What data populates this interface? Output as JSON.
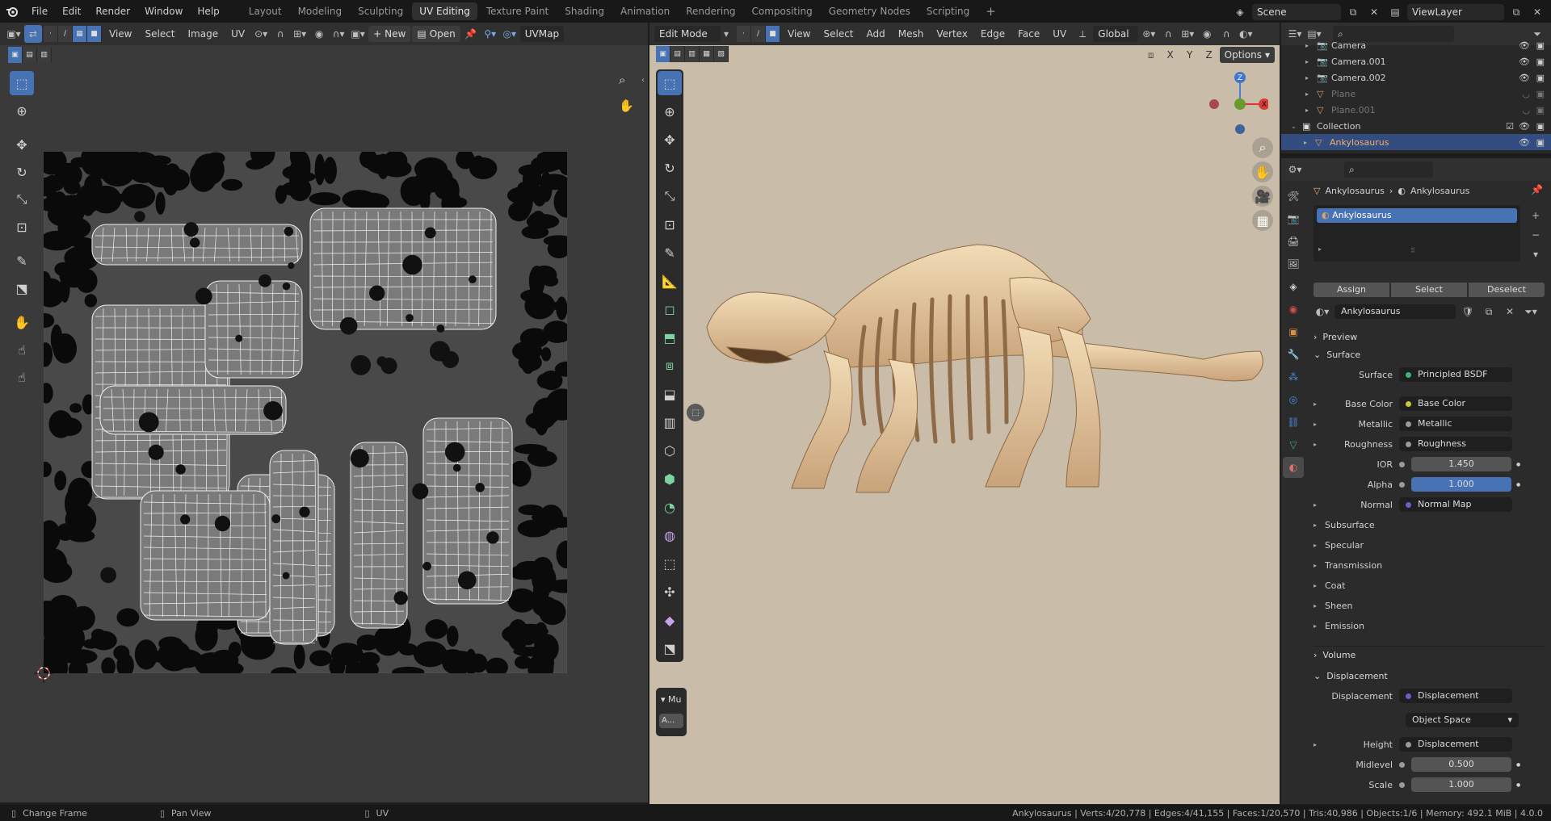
{
  "topbar": {
    "menus": [
      "File",
      "Edit",
      "Render",
      "Window",
      "Help"
    ],
    "workspaces": [
      "Layout",
      "Modeling",
      "Sculpting",
      "UV Editing",
      "Texture Paint",
      "Shading",
      "Animation",
      "Rendering",
      "Compositing",
      "Geometry Nodes",
      "Scripting"
    ],
    "active_workspace": "UV Editing",
    "add_workspace": "+",
    "scene": "Scene",
    "view_layer": "ViewLayer"
  },
  "uv_editor": {
    "menus": [
      "View",
      "Select",
      "Image",
      "UV"
    ],
    "new_label": "New",
    "open_label": "Open",
    "uvmap_label": "UVMap"
  },
  "viewport": {
    "mode": "Edit Mode",
    "menus": [
      "View",
      "Select",
      "Add",
      "Mesh",
      "Vertex",
      "Edge",
      "Face",
      "UV"
    ],
    "orientation": "Global",
    "options_label": "Options",
    "axis_x": "X",
    "axis_y": "Y",
    "axis_z": "Z",
    "gizmo_x": "X",
    "gizmo_z": "Z",
    "last_op_label": "Mu",
    "last_op_short": "A..."
  },
  "outliner": {
    "items": [
      {
        "label": "Camera",
        "kind": "camera",
        "dim": false
      },
      {
        "label": "Camera.001",
        "kind": "camera",
        "dim": false
      },
      {
        "label": "Camera.002",
        "kind": "camera",
        "dim": false
      },
      {
        "label": "Plane",
        "kind": "mesh",
        "dim": true
      },
      {
        "label": "Plane.001",
        "kind": "mesh",
        "dim": true
      },
      {
        "label": "Collection",
        "kind": "collection",
        "dim": false
      },
      {
        "label": "Ankylosaurus",
        "kind": "mesh",
        "dim": false,
        "selected": true
      }
    ]
  },
  "properties": {
    "breadcrumb_object": "Ankylosaurus",
    "breadcrumb_material": "Ankylosaurus",
    "slot_name": "Ankylosaurus",
    "assign_label": "Assign",
    "select_label": "Select",
    "deselect_label": "Deselect",
    "material_name": "Ankylosaurus",
    "preview_label": "Preview",
    "surface_section": "Surface",
    "surface_label": "Surface",
    "surface_value": "Principled BSDF",
    "rows": [
      {
        "label": "Base Color",
        "value": "Base Color",
        "dot": "#c8c83c",
        "expand": true
      },
      {
        "label": "Metallic",
        "value": "Metallic",
        "dot": "#9a9a9a",
        "expand": true
      },
      {
        "label": "Roughness",
        "value": "Roughness",
        "dot": "#9a9a9a",
        "expand": true
      },
      {
        "label": "IOR",
        "value": "1.450",
        "dot": "#9a9a9a",
        "expand": false,
        "style": "grey"
      },
      {
        "label": "Alpha",
        "value": "1.000",
        "dot": "#9a9a9a",
        "expand": false,
        "style": "blue"
      },
      {
        "label": "Normal",
        "value": "Normal Map",
        "dot": "#6363c7",
        "expand": true
      }
    ],
    "subsections": [
      "Subsurface",
      "Specular",
      "Transmission",
      "Coat",
      "Sheen",
      "Emission"
    ],
    "volume_label": "Volume",
    "displacement_section": "Displacement",
    "displacement_label": "Displacement",
    "displacement_value": "Displacement",
    "space_value": "Object Space",
    "height_label": "Height",
    "height_value": "Displacement",
    "midlevel_label": "Midlevel",
    "midlevel_value": "0.500",
    "scale_label": "Scale",
    "scale_value": "1.000"
  },
  "status": {
    "left1": "Change Frame",
    "left2": "Pan View",
    "left3": "UV",
    "stats": "Ankylosaurus | Verts:4/20,778 | Edges:4/41,155 | Faces:1/20,570 | Tris:40,986 | Objects:1/6 | Memory: 492.1 MiB | 4.0.0"
  },
  "colors": {
    "accent": "#4772b3",
    "object_label": "#f0b070",
    "viewport_bg": "#c9bda9"
  }
}
